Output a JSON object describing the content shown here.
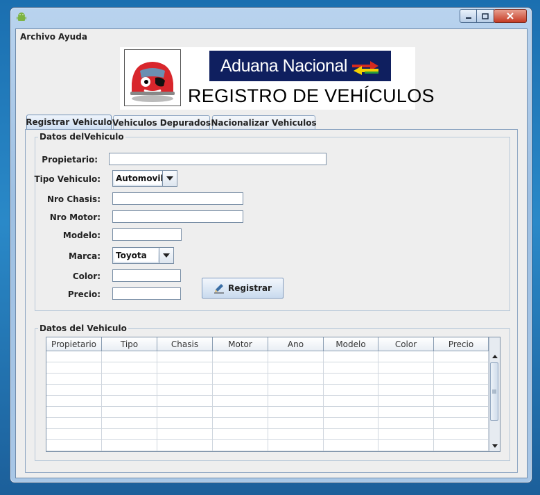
{
  "window": {
    "icon": "android-icon",
    "controls": {
      "minimize": "minimize-icon",
      "maximize": "maximize-icon",
      "close": "close-icon"
    }
  },
  "menu": {
    "archivo": "Archivo",
    "ayuda": "Ayuda"
  },
  "banner": {
    "logo_text": "Aduana Nacional",
    "title": "REGISTRO DE VEHÍCULOS",
    "car_icon": "red-car-logo"
  },
  "tabs": [
    {
      "label": "Registrar Vehiculo",
      "active": true
    },
    {
      "label": "Vehiculos Depurados",
      "active": false
    },
    {
      "label": "Nacionalizar Vehiculos",
      "active": false
    }
  ],
  "form": {
    "group_title": "Datos delVehiculo",
    "propietario": {
      "label": "Propietario:",
      "value": ""
    },
    "tipo": {
      "label": "Tipo Vehiculo:",
      "selected": "Automovil"
    },
    "chasis": {
      "label": "Nro Chasis:",
      "value": ""
    },
    "motor": {
      "label": "Nro Motor:",
      "value": ""
    },
    "modelo": {
      "label": "Modelo:",
      "value": ""
    },
    "marca": {
      "label": "Marca:",
      "selected": "Toyota"
    },
    "color": {
      "label": "Color:",
      "value": ""
    },
    "precio": {
      "label": "Precio:",
      "value": ""
    },
    "registrar_button": "Registrar"
  },
  "table": {
    "group_title": "Datos del Vehiculo",
    "columns": [
      "Propietario",
      "Tipo",
      "Chasis",
      "Motor",
      "Ano",
      "Modelo",
      "Color",
      "Precio"
    ],
    "rows": []
  },
  "colors": {
    "accent": "#0f1f5f",
    "background": "#eeeeee"
  }
}
